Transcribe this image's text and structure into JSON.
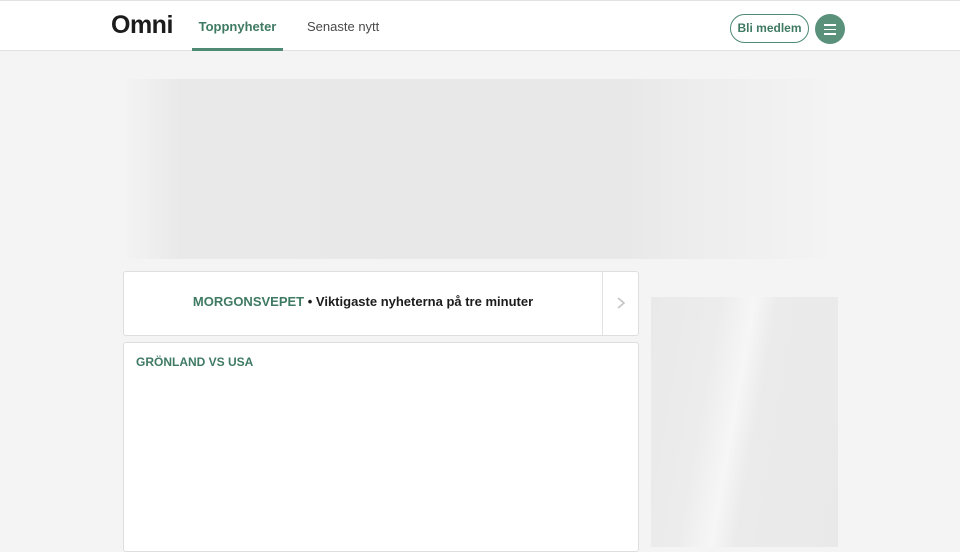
{
  "header": {
    "logo": "Omni",
    "tabs": [
      {
        "label": "Toppnyheter",
        "active": true
      },
      {
        "label": "Senaste nytt",
        "active": false
      }
    ],
    "member_button": "Bli medlem",
    "menu_icon": "hamburger-menu-icon"
  },
  "briefing": {
    "kicker": "MORGONSVEPET",
    "separator": " • ",
    "text": "Viktigaste nyheterna på tre minuter",
    "arrow_icon": "chevron-right-icon"
  },
  "story": {
    "topic": "GRÖNLAND VS USA"
  },
  "colors": {
    "accent": "#3f7a64",
    "accent_button": "#5a917b",
    "background": "#f4f4f4"
  }
}
